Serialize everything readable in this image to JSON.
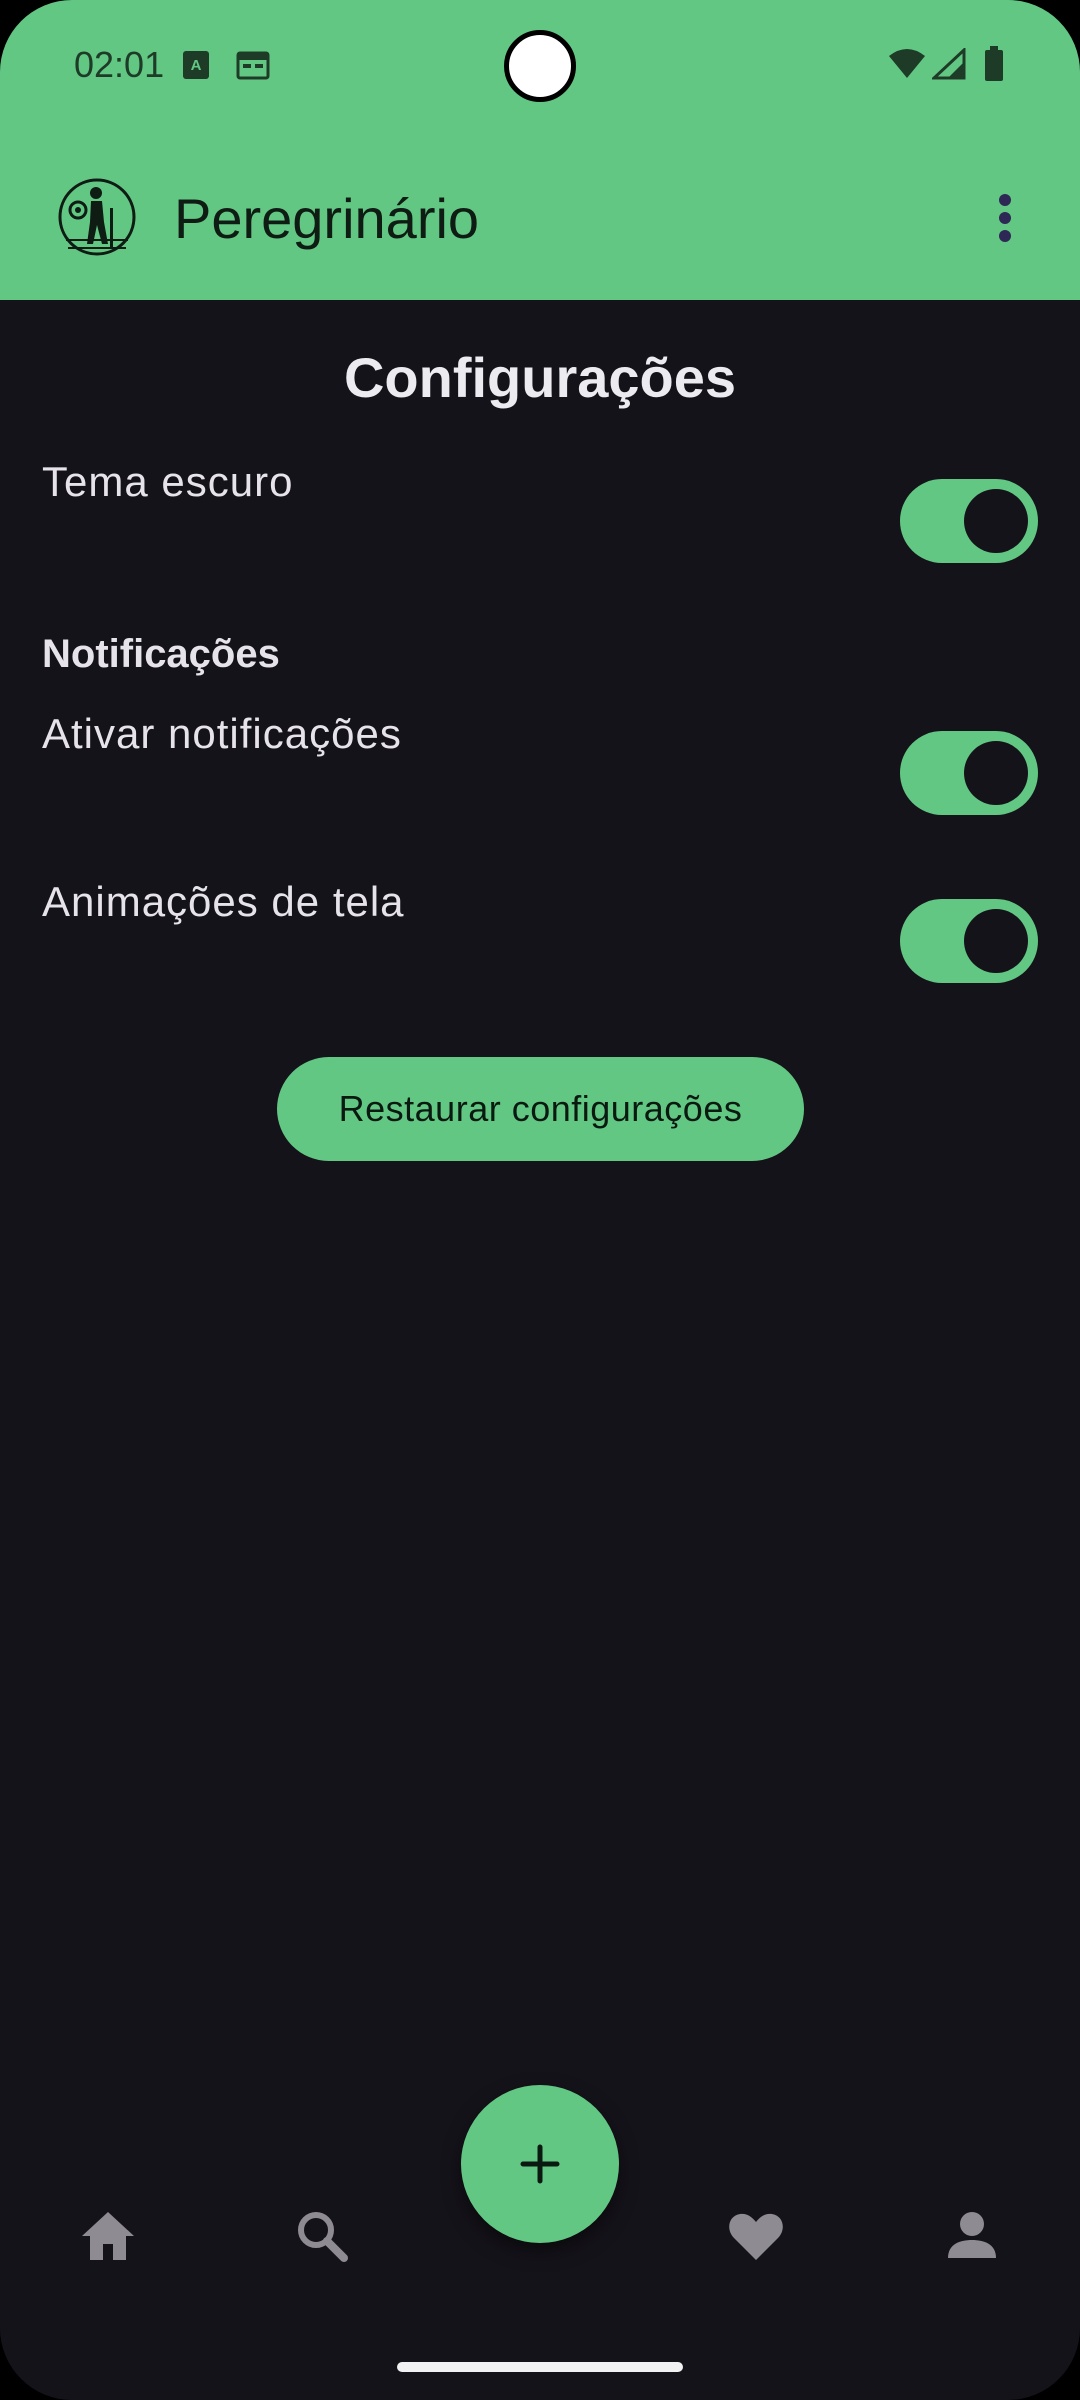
{
  "status_bar": {
    "time": "02:01"
  },
  "app_bar": {
    "title": "Peregrinário"
  },
  "page": {
    "title": "Configurações"
  },
  "settings": {
    "dark_theme": {
      "label": "Tema escuro",
      "enabled": true
    },
    "notifications_header": "Notificações",
    "enable_notifications": {
      "label": "Ativar notificações",
      "enabled": true
    },
    "screen_animations": {
      "label": "Animações de tela",
      "enabled": true
    },
    "restore_button": "Restaurar configurações"
  },
  "bottom_nav": {
    "items": [
      {
        "icon": "home-icon"
      },
      {
        "icon": "search-icon"
      },
      {
        "icon": "add-icon"
      },
      {
        "icon": "heart-icon"
      },
      {
        "icon": "person-icon"
      }
    ]
  },
  "colors": {
    "accent": "#63c784",
    "background": "#15131a",
    "text": "#e6e4ea"
  }
}
